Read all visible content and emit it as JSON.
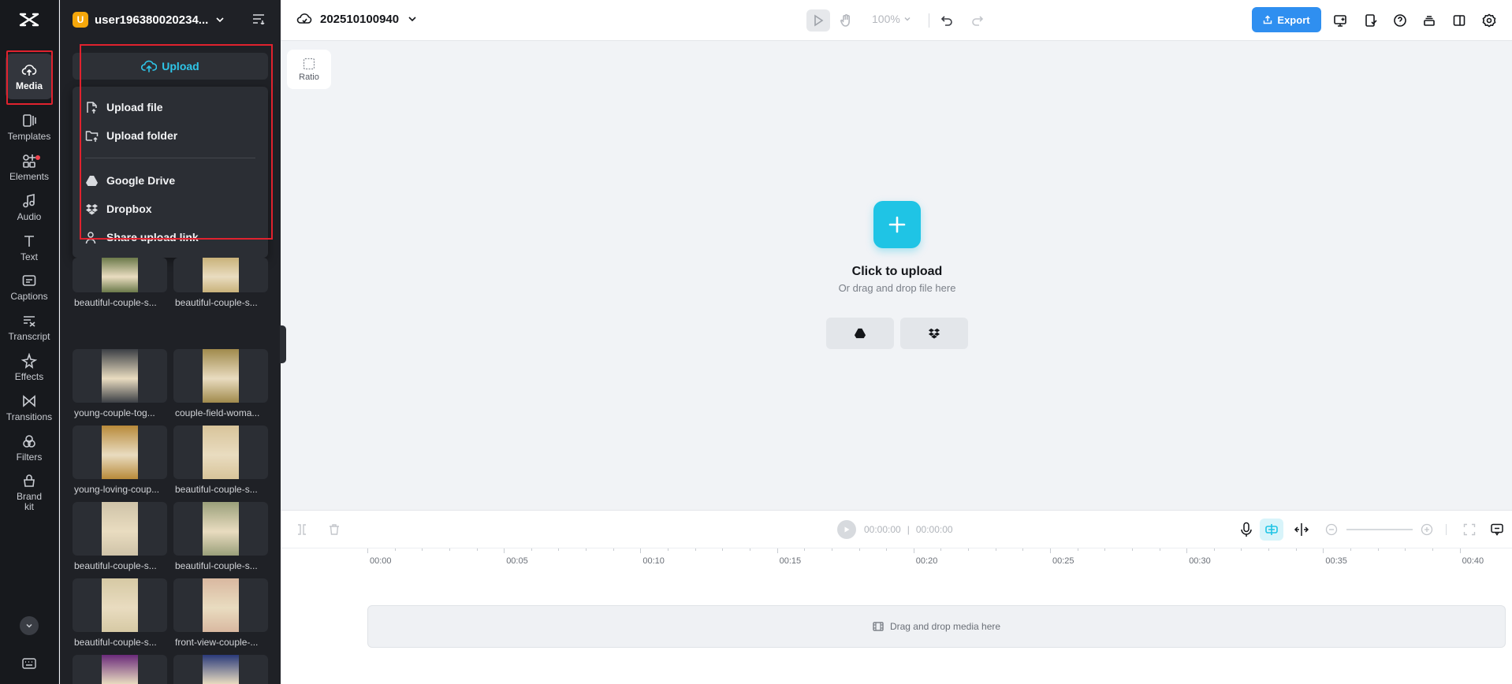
{
  "rail": {
    "items": [
      {
        "label": "Media",
        "icon": "cloud-upload-icon"
      },
      {
        "label": "Templates",
        "icon": "templates-icon"
      },
      {
        "label": "Elements",
        "icon": "elements-icon"
      },
      {
        "label": "Audio",
        "icon": "music-note-icon"
      },
      {
        "label": "Text",
        "icon": "text-icon"
      },
      {
        "label": "Captions",
        "icon": "captions-icon"
      },
      {
        "label": "Transcript",
        "icon": "transcript-icon"
      },
      {
        "label": "Effects",
        "icon": "effects-icon"
      },
      {
        "label": "Transitions",
        "icon": "transitions-icon"
      },
      {
        "label": "Filters",
        "icon": "filters-icon"
      },
      {
        "label": "Brand\nkit",
        "icon": "brand-kit-icon"
      }
    ]
  },
  "panel": {
    "user_initial": "U",
    "user_name": "user19638002023​4...",
    "upload_label": "Upload",
    "menu": {
      "upload_file": "Upload file",
      "upload_folder": "Upload folder",
      "google_drive": "Google Drive",
      "dropbox": "Dropbox",
      "share_link": "Share upload link"
    },
    "media": [
      {
        "name": "beautiful-couple-s...",
        "color": "#6b7a4a"
      },
      {
        "name": "beautiful-couple-s...",
        "color": "#c9b27a"
      },
      {
        "name": "young-couple-tog...",
        "color": "#3b3f45"
      },
      {
        "name": "couple-field-woma...",
        "color": "#a08a4c"
      },
      {
        "name": "young-loving-coup...",
        "color": "#b88a3a"
      },
      {
        "name": "beautiful-couple-s...",
        "color": "#d8c49a"
      },
      {
        "name": "beautiful-couple-s...",
        "color": "#cfc3a8"
      },
      {
        "name": "beautiful-couple-s...",
        "color": "#9aa07a"
      },
      {
        "name": "beautiful-couple-s...",
        "color": "#d6c9a4"
      },
      {
        "name": "front-view-couple-...",
        "color": "#d9b8a0"
      },
      {
        "name": "",
        "color": "#6a2a7a"
      },
      {
        "name": "",
        "color": "#2a3a7a"
      }
    ]
  },
  "topbar": {
    "project_name": "202510100940",
    "zoom": "100%",
    "export_label": "Export"
  },
  "canvas": {
    "ratio_label": "Ratio",
    "click_upload": "Click to upload",
    "drag_text": "Or drag and drop file here"
  },
  "timeline": {
    "current_time": "00:00:00",
    "separator": "|",
    "total_time": "00:00:00",
    "ticks": [
      "00:00",
      "00:05",
      "00:10",
      "00:15",
      "00:20",
      "00:25",
      "00:30",
      "00:35",
      "00:40"
    ],
    "dropzone_text": "Drag and drop media here"
  },
  "colors": {
    "accent": "#1fc4e5",
    "export": "#2f8ff0",
    "highlight": "#e0222e"
  }
}
